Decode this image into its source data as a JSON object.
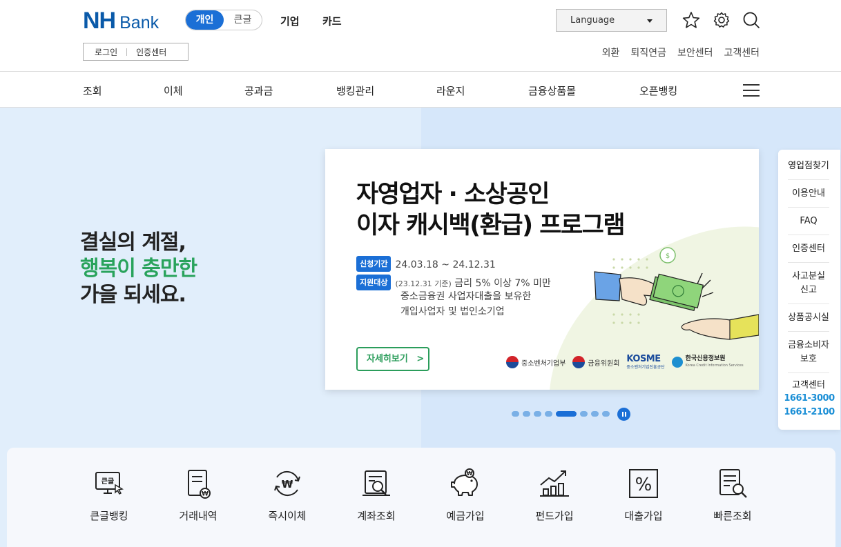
{
  "header": {
    "logo_nh": "NH",
    "logo_bank": "Bank",
    "segment": {
      "personal": "개인",
      "large_text": "큰글"
    },
    "links": {
      "corporate": "기업",
      "card": "카드"
    },
    "language": "Language",
    "login": "로그인",
    "cert_center": "인증센터",
    "util": [
      "외환",
      "퇴직연금",
      "보안센터",
      "고객센터"
    ]
  },
  "gnb": [
    "조회",
    "이체",
    "공과금",
    "뱅킹관리",
    "라운지",
    "금융상품몰",
    "오픈뱅킹"
  ],
  "hero": {
    "line1": "결실의 계절,",
    "line2": "행복이 충만한",
    "line3": "가을 되세요."
  },
  "banner": {
    "title1": "자영업자 · 소상공인",
    "title2": "이자 캐시백(환급) 프로그램",
    "tag_period": "신청기간",
    "period": "24.03.18 ~ 24.12.31",
    "tag_target": "지원대상",
    "target_note": "(23.12.31 기준)",
    "target1": "금리 5% 이상 7% 미만",
    "target2": "중소금융권 사업자대출을 보유한",
    "target3": "개입사업자 및 법인소기업",
    "button": "자세히보기",
    "button_arrow": ">",
    "logo1": "중소벤처기업부",
    "logo2": "금융위원회",
    "logo3": "KOSME",
    "logo3_sub": "중소벤처기업진흥공단",
    "logo4": "한국신용정보원",
    "logo4_sub": "Korea Credit Information Services",
    "logo4_mark": "CIS"
  },
  "slides": {
    "total": 9,
    "active_index": 4
  },
  "quick": {
    "items": [
      "영업점찾기",
      "이용안내",
      "FAQ",
      "인증센터",
      "사고분실",
      "신고",
      "상품공시실",
      "금융소비자",
      "보호",
      "고객센터"
    ],
    "phone1": "1661-3000",
    "phone2": "1661-2100"
  },
  "menu": {
    "items": [
      "큰글뱅킹",
      "거래내역",
      "즉시이체",
      "계좌조회",
      "예금가입",
      "펀드가입",
      "대출가입",
      "빠른조회"
    ],
    "icon_bigtext": "큰글",
    "icon_won": "₩",
    "icon_percent": "%"
  },
  "colors": {
    "brand_blue": "#0a5aa9",
    "accent_blue": "#1b6fd6",
    "green": "#29a35c",
    "phone_blue": "#1b8fd6"
  }
}
